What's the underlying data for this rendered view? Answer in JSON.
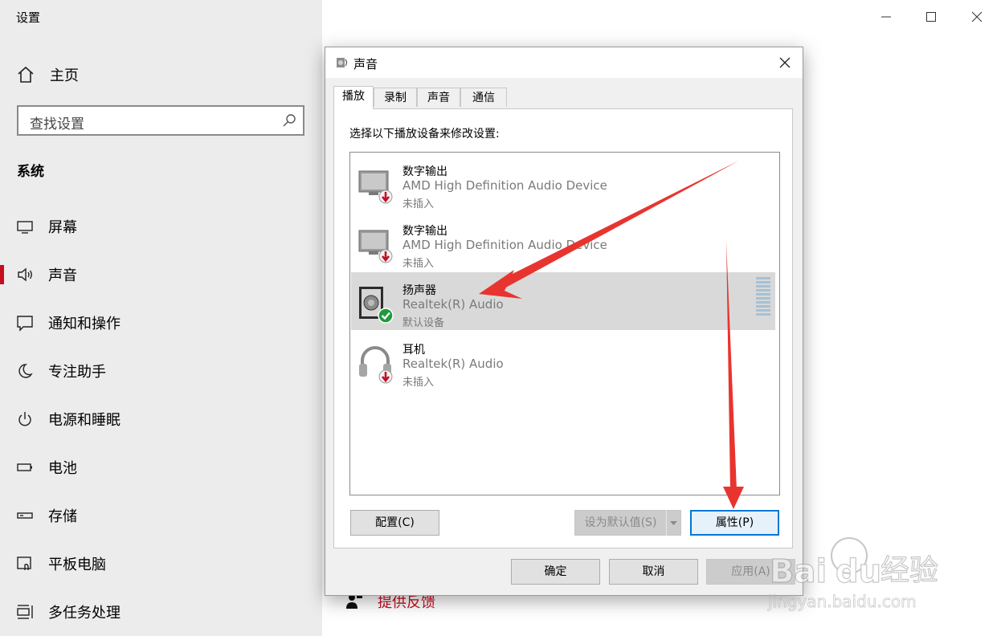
{
  "settings": {
    "app_title": "设置",
    "home_label": "主页",
    "search_placeholder": "查找设置",
    "section_title": "系统",
    "nav_items": [
      {
        "label": "屏幕",
        "icon": "monitor-icon"
      },
      {
        "label": "声音",
        "icon": "speaker-icon",
        "active": true
      },
      {
        "label": "通知和操作",
        "icon": "notification-icon"
      },
      {
        "label": "专注助手",
        "icon": "moon-icon"
      },
      {
        "label": "电源和睡眠",
        "icon": "power-icon"
      },
      {
        "label": "电池",
        "icon": "battery-icon"
      },
      {
        "label": "存储",
        "icon": "storage-icon"
      },
      {
        "label": "平板电脑",
        "icon": "tablet-icon"
      },
      {
        "label": "多任务处理",
        "icon": "multitask-icon"
      }
    ],
    "feedback_label": "提供反馈"
  },
  "dialog": {
    "title": "声音",
    "tabs": [
      {
        "label": "播放",
        "active": true
      },
      {
        "label": "录制"
      },
      {
        "label": "声音"
      },
      {
        "label": "通信"
      }
    ],
    "instruction": "选择以下播放设备来修改设置:",
    "devices": [
      {
        "name": "数字输出",
        "device": "AMD High Definition Audio Device",
        "status": "未插入",
        "icon": "monitor-device-icon",
        "badge": "unplugged"
      },
      {
        "name": "数字输出",
        "device": "AMD High Definition Audio Device",
        "status": "未插入",
        "icon": "monitor-device-icon",
        "badge": "unplugged"
      },
      {
        "name": "扬声器",
        "device": "Realtek(R) Audio",
        "status": "默认设备",
        "icon": "speaker-device-icon",
        "badge": "default",
        "selected": true
      },
      {
        "name": "耳机",
        "device": "Realtek(R) Audio",
        "status": "未插入",
        "icon": "headphones-icon",
        "badge": "unplugged"
      }
    ],
    "buttons": {
      "configure": "配置(C)",
      "set_default": "设为默认值(S)",
      "properties": "属性(P)",
      "ok": "确定",
      "cancel": "取消",
      "apply": "应用(A)"
    }
  },
  "colors": {
    "accent_red": "#c50e1f",
    "focus_blue": "#0078d7",
    "annotation_arrow": "#e8342f",
    "sidebar_bg": "#ececec"
  }
}
